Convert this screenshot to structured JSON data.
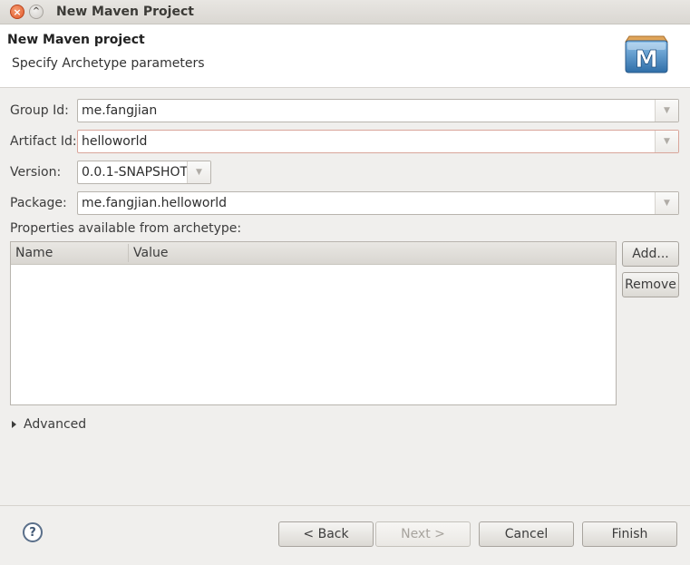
{
  "window": {
    "title": "New Maven Project"
  },
  "header": {
    "title": "New Maven project",
    "subtitle": "Specify Archetype parameters",
    "logo_letter": "M"
  },
  "form": {
    "group_id": {
      "label": "Group Id:",
      "value": "me.fangjian"
    },
    "artifact_id": {
      "label": "Artifact Id:",
      "value": "helloworld"
    },
    "version": {
      "label": "Version:",
      "value": "0.0.1-SNAPSHOT"
    },
    "package": {
      "label": "Package:",
      "value": "me.fangjian.helloworld"
    }
  },
  "properties": {
    "label": "Properties available from archetype:",
    "columns": [
      "Name",
      "Value"
    ],
    "rows": []
  },
  "buttons": {
    "add": "Add...",
    "remove": "Remove",
    "back": "< Back",
    "next": "Next >",
    "cancel": "Cancel",
    "finish": "Finish"
  },
  "advanced": {
    "label": "Advanced"
  },
  "icons": {
    "close": "close-icon",
    "minimize": "minimize-icon",
    "dropdown": "chevron-down-icon",
    "help": "help-icon",
    "expand": "expand-triangle-icon"
  },
  "colors": {
    "accent_close": "#e35b2c",
    "field_active_border": "#d9a59a",
    "logo_blue": "#2f6ea8"
  }
}
